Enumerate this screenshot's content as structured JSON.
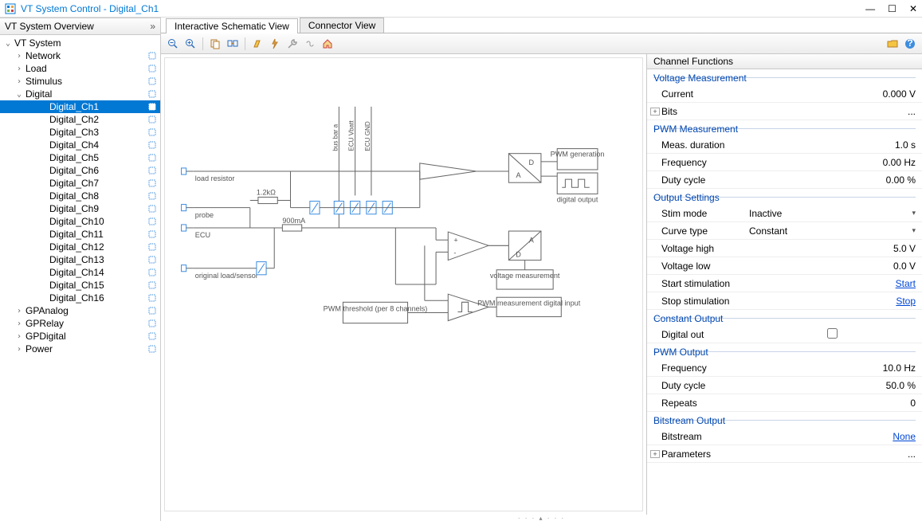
{
  "window": {
    "title": "VT System Control - Digital_Ch1"
  },
  "left_panel": {
    "header": "VT System Overview",
    "tree": [
      {
        "label": "VT System",
        "indent": 0,
        "twisty": "open",
        "dot": false
      },
      {
        "label": "Network",
        "indent": 1,
        "twisty": "closed",
        "dot": true
      },
      {
        "label": "Load",
        "indent": 1,
        "twisty": "closed",
        "dot": true
      },
      {
        "label": "Stimulus",
        "indent": 1,
        "twisty": "closed",
        "dot": true
      },
      {
        "label": "Digital",
        "indent": 1,
        "twisty": "open",
        "dot": true
      },
      {
        "label": "Digital_Ch1",
        "indent": 3,
        "twisty": "none",
        "dot": true,
        "selected": true
      },
      {
        "label": "Digital_Ch2",
        "indent": 3,
        "twisty": "none",
        "dot": true
      },
      {
        "label": "Digital_Ch3",
        "indent": 3,
        "twisty": "none",
        "dot": true
      },
      {
        "label": "Digital_Ch4",
        "indent": 3,
        "twisty": "none",
        "dot": true
      },
      {
        "label": "Digital_Ch5",
        "indent": 3,
        "twisty": "none",
        "dot": true
      },
      {
        "label": "Digital_Ch6",
        "indent": 3,
        "twisty": "none",
        "dot": true
      },
      {
        "label": "Digital_Ch7",
        "indent": 3,
        "twisty": "none",
        "dot": true
      },
      {
        "label": "Digital_Ch8",
        "indent": 3,
        "twisty": "none",
        "dot": true
      },
      {
        "label": "Digital_Ch9",
        "indent": 3,
        "twisty": "none",
        "dot": true
      },
      {
        "label": "Digital_Ch10",
        "indent": 3,
        "twisty": "none",
        "dot": true
      },
      {
        "label": "Digital_Ch11",
        "indent": 3,
        "twisty": "none",
        "dot": true
      },
      {
        "label": "Digital_Ch12",
        "indent": 3,
        "twisty": "none",
        "dot": true
      },
      {
        "label": "Digital_Ch13",
        "indent": 3,
        "twisty": "none",
        "dot": true
      },
      {
        "label": "Digital_Ch14",
        "indent": 3,
        "twisty": "none",
        "dot": true
      },
      {
        "label": "Digital_Ch15",
        "indent": 3,
        "twisty": "none",
        "dot": true
      },
      {
        "label": "Digital_Ch16",
        "indent": 3,
        "twisty": "none",
        "dot": true
      },
      {
        "label": "GPAnalog",
        "indent": 1,
        "twisty": "closed",
        "dot": true
      },
      {
        "label": "GPRelay",
        "indent": 1,
        "twisty": "closed",
        "dot": true
      },
      {
        "label": "GPDigital",
        "indent": 1,
        "twisty": "closed",
        "dot": true
      },
      {
        "label": "Power",
        "indent": 1,
        "twisty": "closed",
        "dot": true
      }
    ]
  },
  "tabs": {
    "items": [
      {
        "label": "Interactive Schematic View",
        "active": true
      },
      {
        "label": "Connector View",
        "active": false
      }
    ]
  },
  "schematic_labels": {
    "load_resistor": "load resistor",
    "probe": "probe",
    "ecu": "ECU",
    "orig_load": "original load/sensor",
    "r_val": "1.2kΩ",
    "fuse_val": "900mA",
    "bus_bar": "bus bar a",
    "ecu_vbatt": "ECU Vbatt",
    "ecu_gnd": "ECU GND",
    "pwm_gen": "PWM generation",
    "dig_out": "digital output",
    "volt_meas": "voltage measurement",
    "pwm_meas": "PWM measurement digital input",
    "pwm_thresh": "PWM threshold (per 8 channels)"
  },
  "props": {
    "header": "Channel Functions",
    "groups": {
      "voltage_meas": {
        "title": "Voltage Measurement",
        "current_lbl": "Current",
        "current_val": "0.000 V",
        "bits_lbl": "Bits",
        "bits_val": "..."
      },
      "pwm_meas": {
        "title": "PWM Measurement",
        "dur_lbl": "Meas. duration",
        "dur_val": "1.0 s",
        "freq_lbl": "Frequency",
        "freq_val": "0.00 Hz",
        "duty_lbl": "Duty cycle",
        "duty_val": "0.00 %"
      },
      "output_settings": {
        "title": "Output Settings",
        "stim_lbl": "Stim mode",
        "stim_val": "Inactive",
        "curve_lbl": "Curve type",
        "curve_val": "Constant",
        "vhigh_lbl": "Voltage high",
        "vhigh_val": "5.0 V",
        "vlow_lbl": "Voltage low",
        "vlow_val": "0.0 V",
        "start_lbl": "Start stimulation",
        "start_link": "Start",
        "stop_lbl": "Stop stimulation",
        "stop_link": "Stop"
      },
      "const_out": {
        "title": "Constant Output",
        "digout_lbl": "Digital out"
      },
      "pwm_out": {
        "title": "PWM Output",
        "freq_lbl": "Frequency",
        "freq_val": "10.0 Hz",
        "duty_lbl": "Duty cycle",
        "duty_val": "50.0 %",
        "rep_lbl": "Repeats",
        "rep_val": "0"
      },
      "bitstream": {
        "title": "Bitstream Output",
        "bs_lbl": "Bitstream",
        "bs_link": "None",
        "params_lbl": "Parameters",
        "params_val": "..."
      }
    }
  }
}
